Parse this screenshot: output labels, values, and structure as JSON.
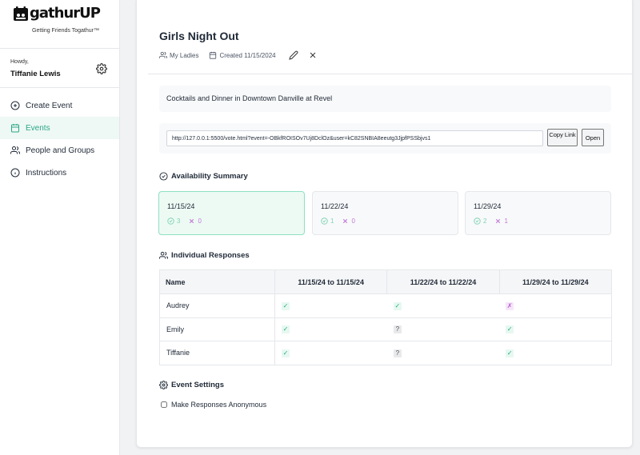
{
  "sidebar": {
    "logo_text": "gathurUP",
    "tagline": "Getting Friends Togathur™",
    "greeting": "Howdy,",
    "user_name": "Tiffanie Lewis",
    "nav": [
      {
        "label": "Create Event",
        "icon": "plus-circle-icon"
      },
      {
        "label": "Events",
        "icon": "calendar-icon",
        "active": true
      },
      {
        "label": "People and Groups",
        "icon": "users-icon"
      },
      {
        "label": "Instructions",
        "icon": "info-icon"
      }
    ]
  },
  "event": {
    "title": "Girls Night Out",
    "group": "My Ladies",
    "created": "Created 11/15/2024",
    "description": "Cocktails and Dinner in Downtown Danville at Revel",
    "vote_link": "http://127.0.0.1:5500/vote.html?event=-OBkfROISOv7Uj8DclOz&user=kC82SNBIA8eeutg3JjpfPSSbjvs1",
    "copy_label": "Copy Link",
    "open_label": "Open"
  },
  "availability": {
    "heading": "Availability Summary",
    "dates": [
      {
        "date": "11/15/24",
        "yes": "3",
        "no": "0",
        "best": true
      },
      {
        "date": "11/22/24",
        "yes": "1",
        "no": "0"
      },
      {
        "date": "11/29/24",
        "yes": "2",
        "no": "1"
      }
    ]
  },
  "responses": {
    "heading": "Individual Responses",
    "columns": [
      "Name",
      "11/15/24 to 11/15/24",
      "11/22/24 to 11/22/24",
      "11/29/24 to 11/29/24"
    ],
    "rows": [
      {
        "name": "Audrey",
        "marks": [
          "✓",
          "✓",
          "✗"
        ]
      },
      {
        "name": "Emily",
        "marks": [
          "✓",
          "?",
          "✓"
        ]
      },
      {
        "name": "Tiffanie",
        "marks": [
          "✓",
          "?",
          "✓"
        ]
      }
    ]
  },
  "settings": {
    "heading": "Event Settings",
    "anonymous_label": "Make Responses Anonymous",
    "anonymous_checked": false
  },
  "colors": {
    "accent": "#2aa884",
    "yes": "#7fd3b5",
    "no": "#c07ad6"
  }
}
